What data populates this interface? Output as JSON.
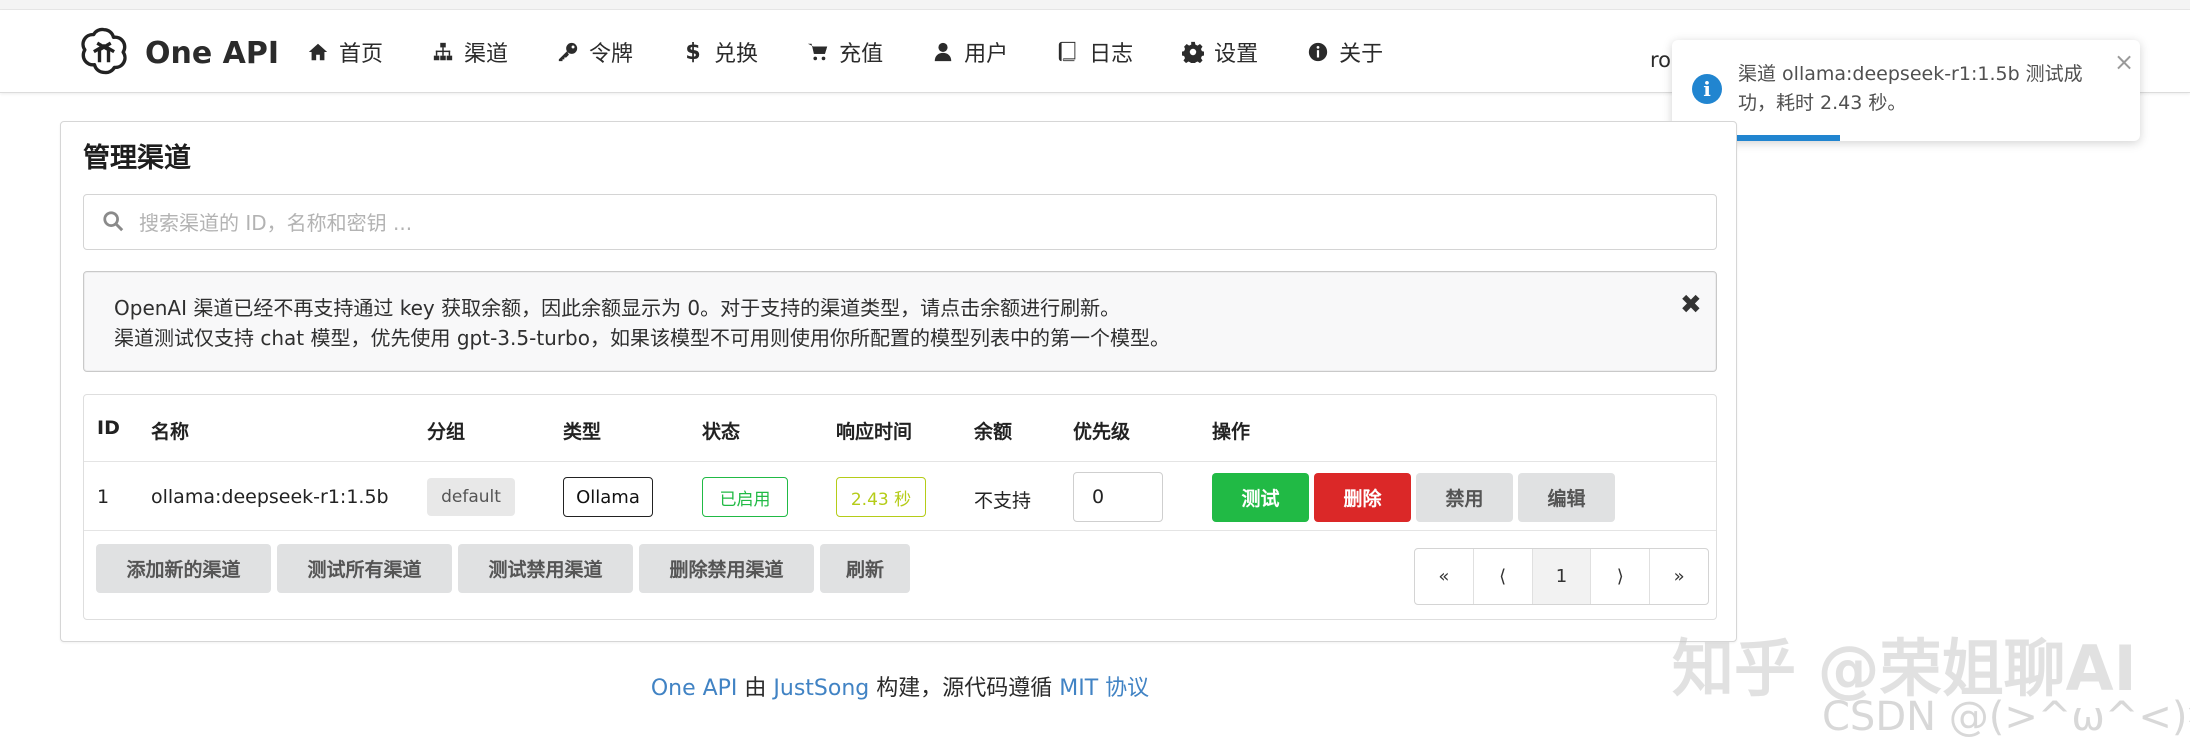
{
  "header": {
    "brand": "One API",
    "nav": [
      {
        "label": "首页",
        "icon": "home-icon"
      },
      {
        "label": "渠道",
        "icon": "sitemap-icon"
      },
      {
        "label": "令牌",
        "icon": "key-icon"
      },
      {
        "label": "兑换",
        "icon": "dollar-icon"
      },
      {
        "label": "充值",
        "icon": "cart-icon"
      },
      {
        "label": "用户",
        "icon": "user-icon"
      },
      {
        "label": "日志",
        "icon": "book-icon"
      },
      {
        "label": "设置",
        "icon": "gear-icon"
      },
      {
        "label": "关于",
        "icon": "info-icon"
      }
    ],
    "user_abbr": "ro"
  },
  "toast": {
    "message": "渠道 ollama:deepseek-r1:1.5b 测试成功，耗时 2.43 秒。",
    "close": "×",
    "progress_fraction": 0.36,
    "accent": "#2185d0"
  },
  "card": {
    "title": "管理渠道",
    "search_placeholder": "搜索渠道的 ID，名称和密钥 ...",
    "notice": {
      "line1": "OpenAI 渠道已经不再支持通过 key 获取余额，因此余额显示为 0。对于支持的渠道类型，请点击余额进行刷新。",
      "line2": "渠道测试仅支持 chat 模型，优先使用 gpt-3.5-turbo，如果该模型不可用则使用你所配置的模型列表中的第一个模型。",
      "close": "✖"
    },
    "table": {
      "headers": [
        "ID",
        "名称",
        "分组",
        "类型",
        "状态",
        "响应时间",
        "余额",
        "优先级",
        "操作"
      ],
      "rows": [
        {
          "id": "1",
          "name": "ollama:deepseek-r1:1.5b",
          "group": "default",
          "type": "Ollama",
          "status": "已启用",
          "response_time": "2.43 秒",
          "balance": "不支持",
          "priority": "0",
          "actions": {
            "test": "测试",
            "delete": "删除",
            "disable": "禁用",
            "edit": "编辑"
          }
        }
      ]
    },
    "footer_buttons": [
      "添加新的渠道",
      "测试所有渠道",
      "测试禁用渠道",
      "删除禁用渠道",
      "刷新"
    ],
    "pager": [
      "«",
      "⟨",
      "1",
      "⟩",
      "»"
    ]
  },
  "footer": {
    "one_api": "One API",
    "by": " 由 ",
    "author": "JustSong",
    "built": " 构建，源代码遵循 ",
    "license": "MIT 协议"
  },
  "watermark": {
    "zhihu": "知乎 @荣姐聊AI",
    "csdn": "CSDN @(>^ω^<)猫"
  },
  "colors": {
    "green": "#21ba45",
    "red": "#db2828",
    "olive": "#b5cc18",
    "link": "#4183c4",
    "info": "#2185d0"
  }
}
